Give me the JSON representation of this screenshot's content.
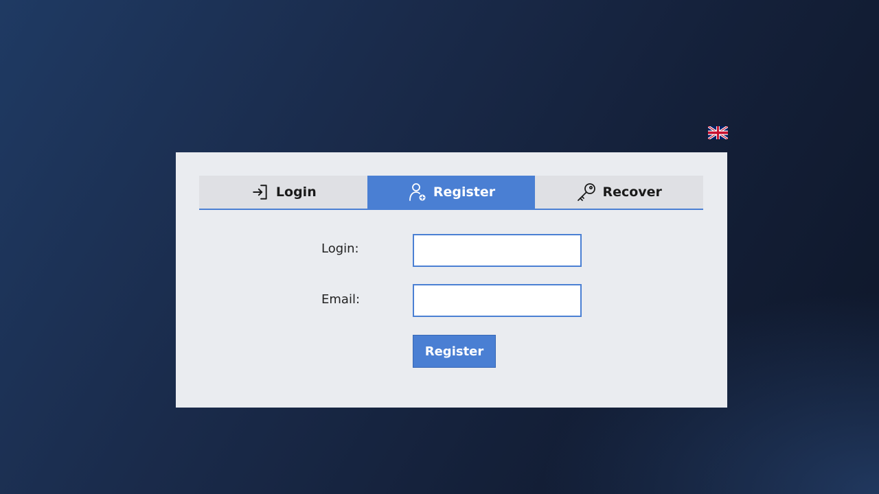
{
  "language": {
    "icon": "uk-flag-icon",
    "colors": {
      "blue": "#012169",
      "white": "#ffffff",
      "red": "#c8102e"
    }
  },
  "tabs": [
    {
      "label": "Login",
      "icon": "sign-in-icon",
      "active": false
    },
    {
      "label": "Register",
      "icon": "add-user-icon",
      "active": true
    },
    {
      "label": "Recover",
      "icon": "key-icon",
      "active": false
    }
  ],
  "form": {
    "login": {
      "label": "Login:",
      "value": "",
      "placeholder": ""
    },
    "email": {
      "label": "Email:",
      "value": "",
      "placeholder": ""
    },
    "submit_label": "Register"
  },
  "colors": {
    "accent": "#4a7fd3",
    "panel_bg": "#eaecf0",
    "tab_bg": "#dfe0e4"
  }
}
